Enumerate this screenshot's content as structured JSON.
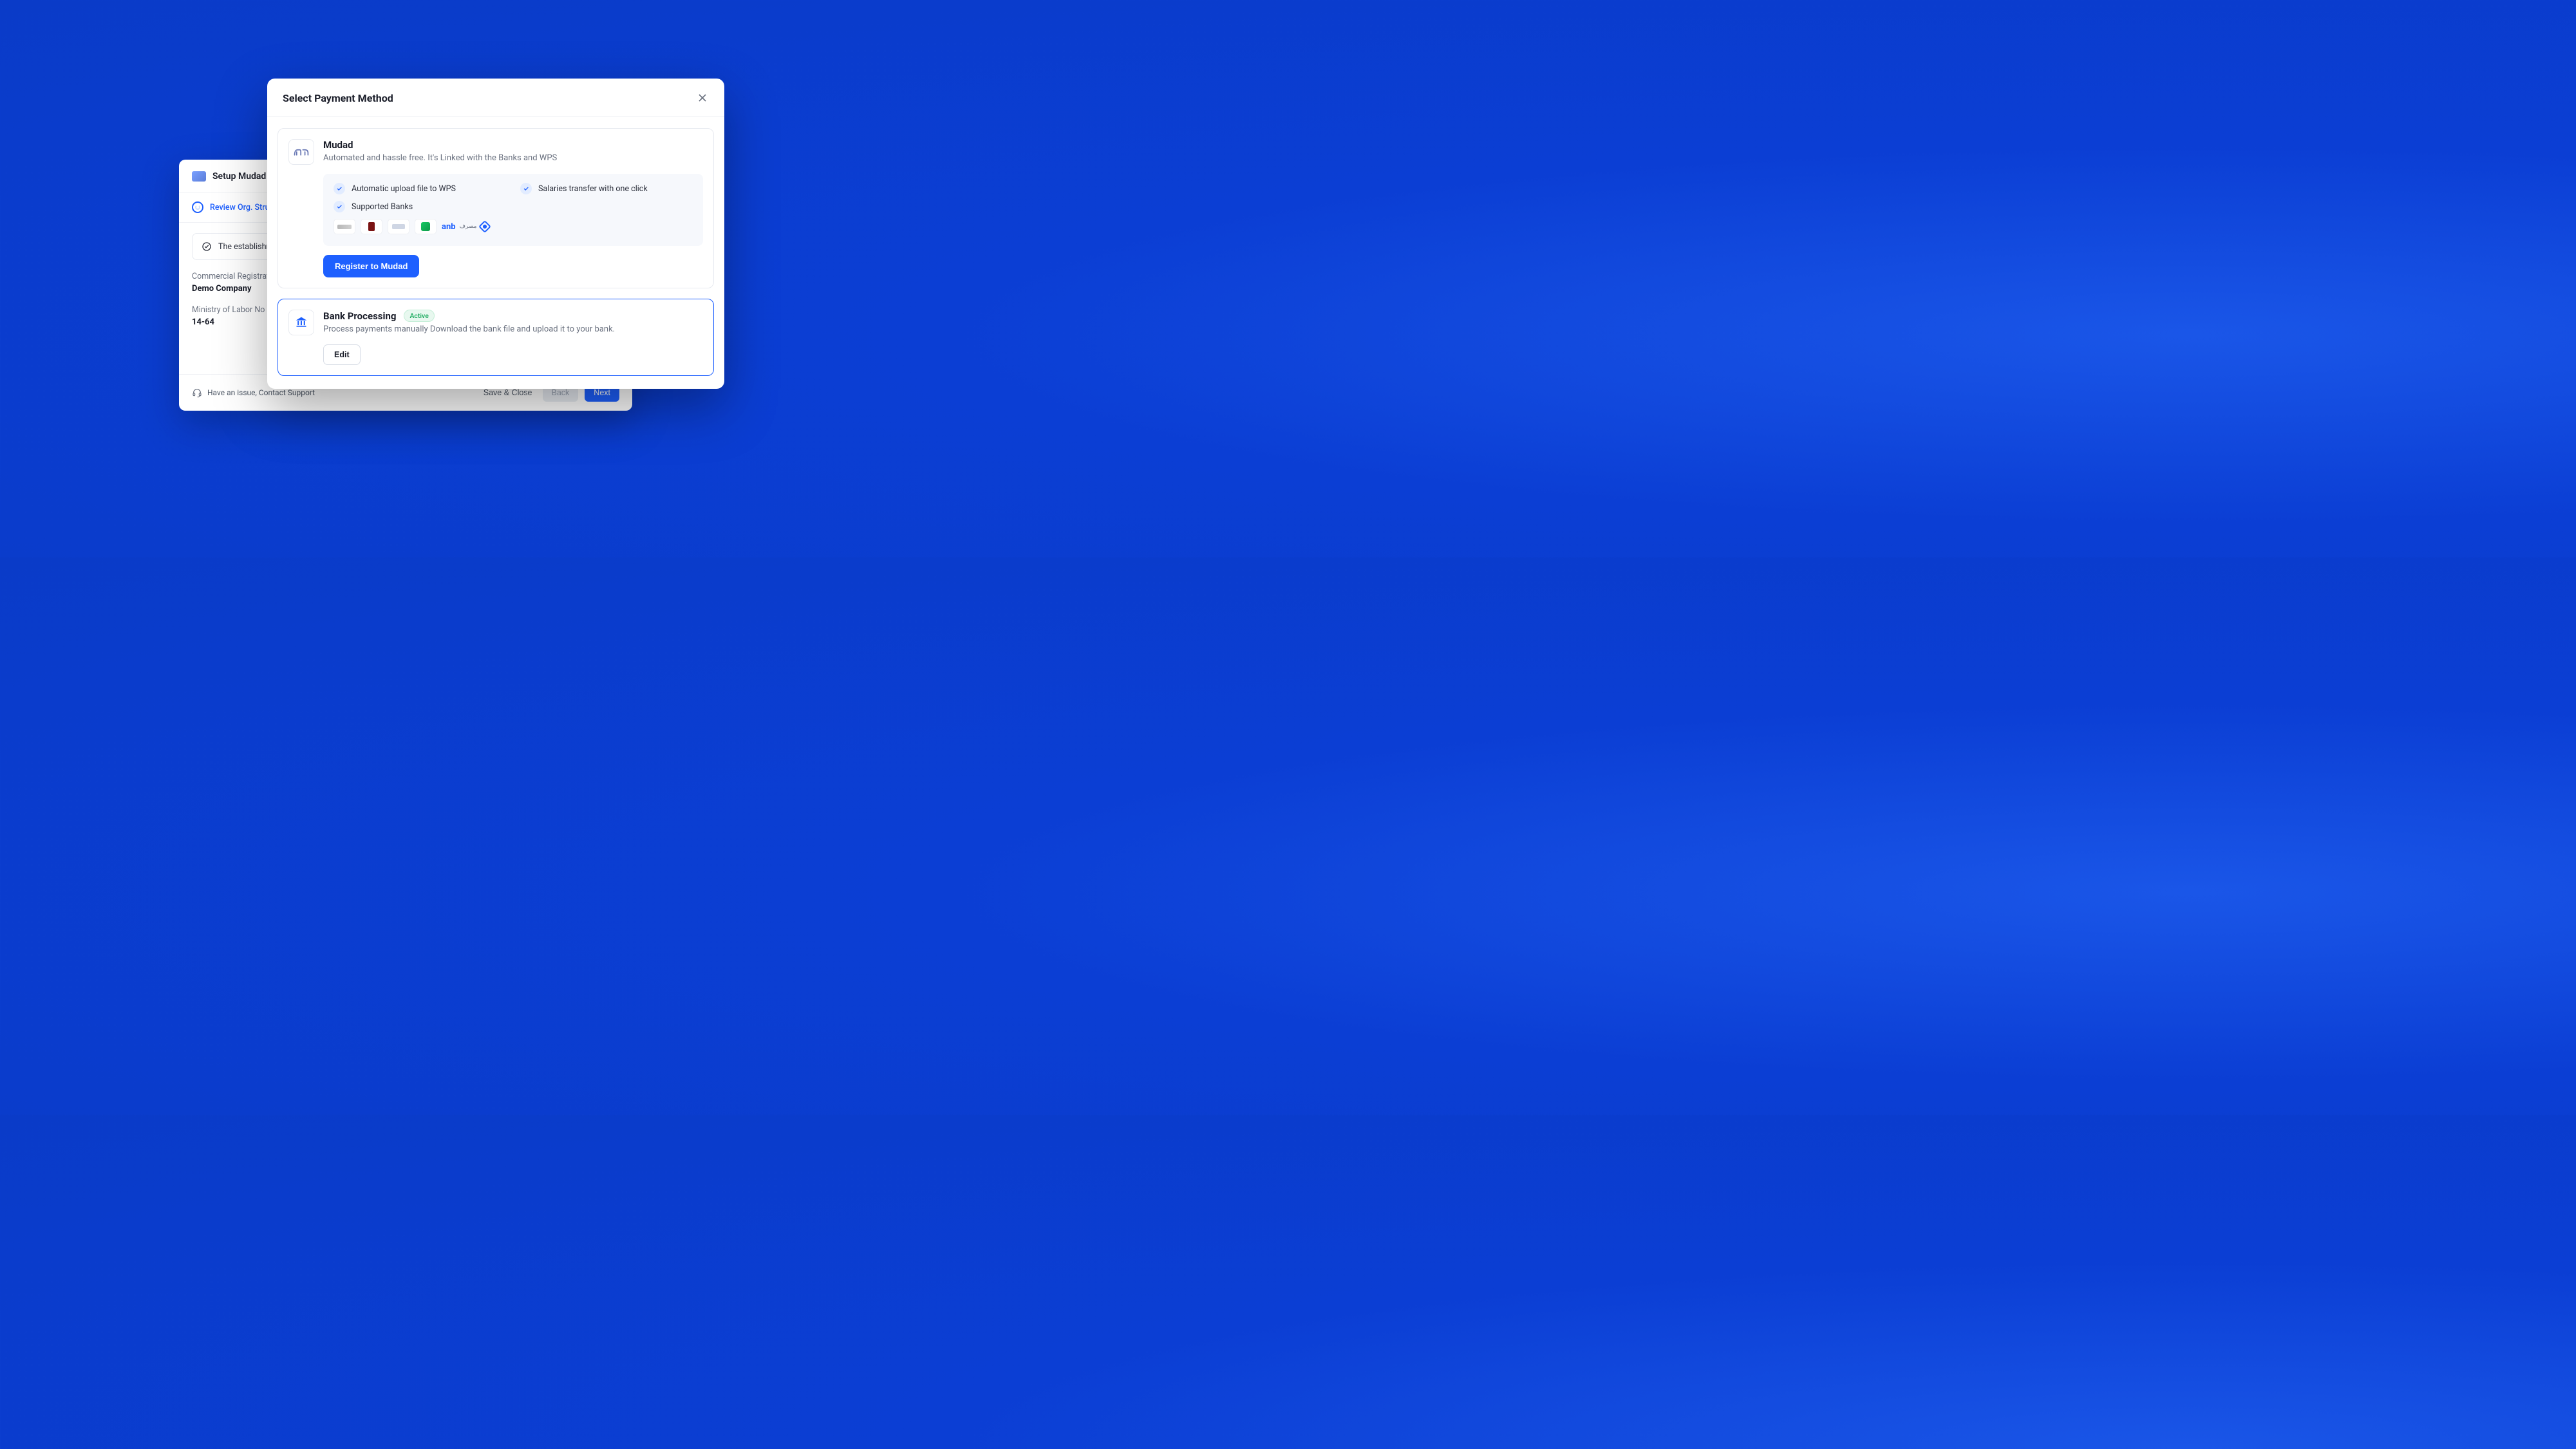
{
  "wizard": {
    "title": "Setup Mudad",
    "step_label": "Review Org. Structure",
    "establishment_text": "The establishment with i",
    "fields": {
      "crn_label": "Commercial Registration Nai",
      "crn_value": "Demo Company",
      "mol_label": "Ministry of Labor No",
      "mol_value": "14-64"
    },
    "support_text": "Have an issue, Contact Support",
    "footer": {
      "save_close": "Save & Close",
      "back": "Back",
      "next": "Next"
    }
  },
  "modal": {
    "title": "Select Payment Method",
    "mudad": {
      "title": "Mudad",
      "desc": "Automated and hassle free. It's Linked with the Banks and WPS",
      "feature_auto": "Automatic upload file to WPS",
      "feature_salaries": "Salaries transfer with one click",
      "feature_banks": "Supported Banks",
      "anb_label": "anb",
      "register_label": "Register to Mudad"
    },
    "bank": {
      "title": "Bank Processing",
      "badge": "Active",
      "desc": "Process payments manually Download the bank file and upload it to your bank.",
      "edit_label": "Edit"
    }
  }
}
